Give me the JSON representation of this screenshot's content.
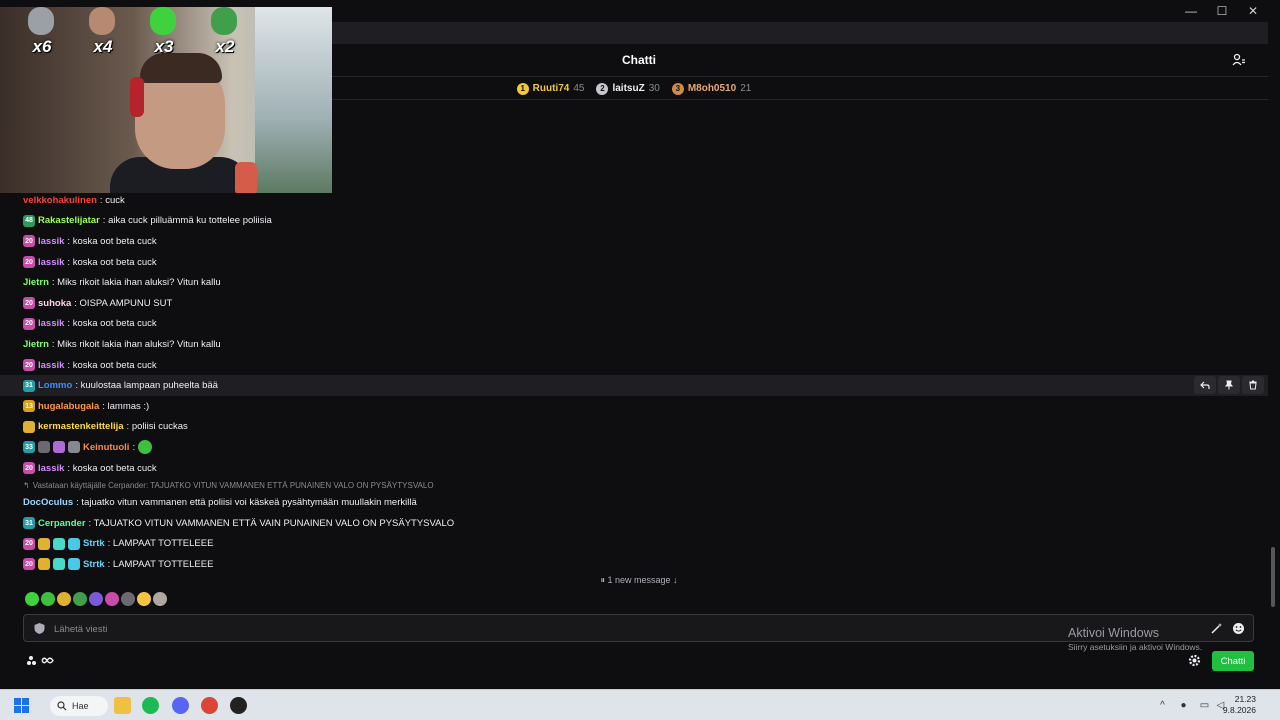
{
  "window": {
    "minimize": "—",
    "maximize": "☐",
    "close": "✕"
  },
  "header": {
    "title": "Chatti"
  },
  "leaderboard": [
    {
      "rank": "1",
      "name": "Ruuti74",
      "score": "45",
      "color": "#f5c542",
      "badge_color": "#f5c542"
    },
    {
      "rank": "2",
      "name": "laitsuZ",
      "score": "30",
      "color": "#efeff1",
      "badge_color": "#c8c8cc"
    },
    {
      "rank": "3",
      "name": "M8oh0510",
      "score": "21",
      "color": "#e8a86a",
      "badge_color": "#d08a4a"
    }
  ],
  "webcam": {
    "emotes": [
      {
        "count": "x6",
        "color": "#9aa0a6"
      },
      {
        "count": "x4",
        "color": "#b58a70"
      },
      {
        "count": "x3",
        "color": "#3fd23f"
      },
      {
        "count": "x2",
        "color": "#3f9f4a"
      }
    ]
  },
  "messages": [
    {
      "user": "velkkohakulinen",
      "color": "#ff3c3c",
      "badges": [],
      "text": ": cuck"
    },
    {
      "user": "Rakastelijatar",
      "color": "#9cff5a",
      "badges": [
        {
          "label": "48",
          "color": "#2f9a5f"
        }
      ],
      "text": ": aika cuck pilluämmä ku tottelee poliisia"
    },
    {
      "user": "lassik",
      "color": "#d28cff",
      "badges": [
        {
          "label": "20",
          "color": "#c84ca8"
        }
      ],
      "text": ": koska oot beta cuck"
    },
    {
      "user": "lassik",
      "color": "#d28cff",
      "badges": [
        {
          "label": "20",
          "color": "#c84ca8"
        }
      ],
      "text": ": koska oot beta cuck"
    },
    {
      "user": "Jietrn",
      "color": "#7cff6a",
      "badges": [],
      "text": ": Miks rikoit lakia ihan aluksi? Vitun kallu"
    },
    {
      "user": "suhoka",
      "color": "#ffd1e8",
      "badges": [
        {
          "label": "20",
          "color": "#c84ca8"
        }
      ],
      "text": ": OISPA AMPUNU SUT"
    },
    {
      "user": "lassik",
      "color": "#d28cff",
      "badges": [
        {
          "label": "20",
          "color": "#c84ca8"
        }
      ],
      "text": ": koska oot beta cuck"
    },
    {
      "user": "Jietrn",
      "color": "#7cff6a",
      "badges": [],
      "text": ": Miks rikoit lakia ihan aluksi? Vitun kallu"
    },
    {
      "user": "lassik",
      "color": "#d28cff",
      "badges": [
        {
          "label": "20",
          "color": "#c84ca8"
        }
      ],
      "text": ": koska oot beta cuck"
    },
    {
      "user": "Lommo",
      "color": "#3c8cff",
      "badges": [
        {
          "label": "31",
          "color": "#1fa0a8"
        }
      ],
      "text": ": kuulostaa lampaan puheelta bää",
      "hover": true
    },
    {
      "user": "hugalabugala",
      "color": "#ff9a3c",
      "badges": [
        {
          "label": "13",
          "color": "#d8a020"
        }
      ],
      "text": ": lammas :)"
    },
    {
      "user": "kermastenkeittelija",
      "color": "#ffd84a",
      "badges": [
        {
          "label": "",
          "color": "#e0b030"
        }
      ],
      "text": ": poliisi cuckas"
    },
    {
      "user": "Keinutuoli",
      "color": "#ff8a3c",
      "badges": [
        {
          "label": "33",
          "color": "#1fa0a8"
        },
        {
          "label": "",
          "color": "#6a6a70"
        },
        {
          "label": "",
          "color": "#b06ad8"
        },
        {
          "label": "",
          "color": "#888890"
        }
      ],
      "text": ":",
      "emote": true
    },
    {
      "user": "lassik",
      "color": "#d28cff",
      "badges": [
        {
          "label": "20",
          "color": "#c84ca8"
        }
      ],
      "text": ": koska oot beta cuck"
    }
  ],
  "reply": {
    "context": "Vastataan käyttäjälle Cerpander: TAJUATKO VITUN VAMMANEN ETTÄ PUNAINEN VALO ON PYSÄYTYSVALO",
    "user": "DocOculus",
    "color": "#9cd8ff",
    "text": ": tajuatko vitun vammanen että poliisi voi käskeä pysähtymään muullakin merkillä"
  },
  "after_reply": [
    {
      "user": "Cerpander",
      "color": "#5aff9a",
      "badges": [
        {
          "label": "31",
          "color": "#1fa0a8"
        }
      ],
      "text": ": TAJUATKO VITUN VAMMANEN ETTÄ VAIN PUNAINEN VALO ON PYSÄYTYSVALO"
    },
    {
      "user": "Strtk",
      "color": "#5ad8ff",
      "badges": [
        {
          "label": "20",
          "color": "#c84ca8"
        },
        {
          "label": "",
          "color": "#e0b030"
        },
        {
          "label": "",
          "color": "#4ad8c8"
        },
        {
          "label": "",
          "color": "#4ac8e8"
        }
      ],
      "text": ": LAMPAAT TOTTELEEE"
    },
    {
      "user": "Strtk",
      "color": "#5ad8ff",
      "badges": [
        {
          "label": "20",
          "color": "#c84ca8"
        },
        {
          "label": "",
          "color": "#e0b030"
        },
        {
          "label": "",
          "color": "#4ad8c8"
        },
        {
          "label": "",
          "color": "#4ac8e8"
        }
      ],
      "text": ": LAMPAAT TOTTELEEE"
    }
  ],
  "new_messages": "⏸ 1 new message ↓",
  "emote_row_colors": [
    "#3fd23f",
    "#3fbf3f",
    "#e0b030",
    "#3f9f4a",
    "#7a5ad8",
    "#c84ca8",
    "#6a6a70",
    "#f5c542",
    "#b0a8a0"
  ],
  "input": {
    "placeholder": "Lähetä viesti"
  },
  "watermark": {
    "title": "Aktivoi Windows",
    "subtitle": "Siirry asetuksiin ja aktivoi Windows."
  },
  "footer": {
    "chat_button": "Chatti"
  },
  "taskbar": {
    "search": "Hae",
    "time": "21.23",
    "date": "9.8.2026"
  }
}
